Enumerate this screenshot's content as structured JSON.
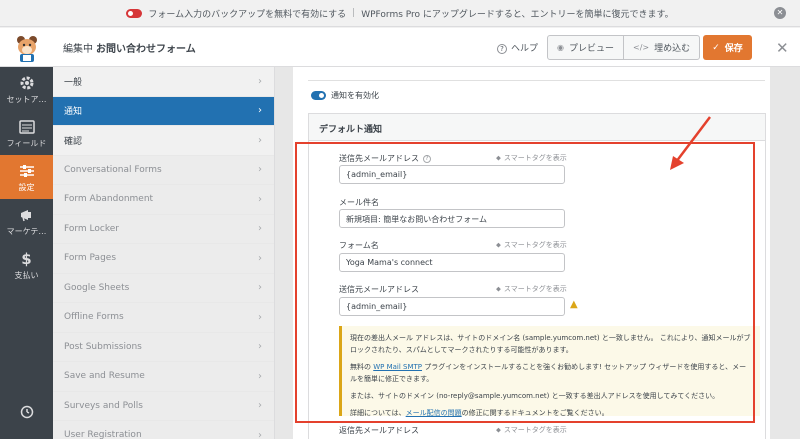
{
  "notice": {
    "toggle_text": "フォーム入力のバックアップを無料で有効にする",
    "separator": "|",
    "upgrade_text": "WPForms Pro にアップグレードすると、エントリーを簡単に復元できます。"
  },
  "header": {
    "editing_prefix": "編集中",
    "form_name": "お問い合わせフォーム",
    "help": "ヘルプ",
    "preview": "プレビュー",
    "embed": "埋め込む",
    "save": "保存"
  },
  "iconbar": {
    "items": [
      {
        "label": "セットア…",
        "icon": "gear-icon"
      },
      {
        "label": "フィールド",
        "icon": "fields-icon"
      },
      {
        "label": "設定",
        "icon": "sliders-icon"
      },
      {
        "label": "マーケテ…",
        "icon": "megaphone-icon"
      },
      {
        "label": "支払い",
        "icon": "dollar-icon"
      }
    ]
  },
  "subnav": {
    "items": [
      {
        "label": "一般"
      },
      {
        "label": "通知"
      },
      {
        "label": "確認"
      },
      {
        "label": "Conversational Forms"
      },
      {
        "label": "Form Abandonment"
      },
      {
        "label": "Form Locker"
      },
      {
        "label": "Form Pages"
      },
      {
        "label": "Google Sheets"
      },
      {
        "label": "Offline Forms"
      },
      {
        "label": "Post Submissions"
      },
      {
        "label": "Save and Resume"
      },
      {
        "label": "Surveys and Polls"
      },
      {
        "label": "User Registration"
      }
    ]
  },
  "main": {
    "enable_label": "通知を有効化",
    "section_title": "デフォルト通知",
    "smart_tag": "スマートタグを表示",
    "fields": [
      {
        "label": "送信先メールアドレス",
        "value": "{admin_email}"
      },
      {
        "label": "メール件名",
        "value": "新規項目: 簡単なお問い合わせフォーム"
      },
      {
        "label": "フォーム名",
        "value": "Yoga Mama's connect"
      },
      {
        "label": "送信元メールアドレス",
        "value": "{admin_email}"
      }
    ],
    "alert": {
      "p1": "現在の差出人メール アドレスは、サイトのドメイン名 (sample.yumcom.net) と一致しません。 これにより、通知メールがブロックされたり、スパムとしてマークされたりする可能性があります。",
      "p2_pre": "無料の",
      "p2_link": "WP Mail SMTP",
      "p2_post": "プラグインをインストールすることを強くお勧めします! セットアップ ウィザードを使用すると、メールを簡単に修正できます。",
      "p3": "または、サイトのドメイン (no-reply@sample.yumcom.net) と一致する差出人アドレスを使用してみてください。",
      "p4_pre": "詳細については、",
      "p4_link": "メール配信の問題",
      "p4_post": "の修正に関するドキュメントをご覧ください。"
    },
    "next_label": "返信先メールアドレス"
  },
  "colors": {
    "accent": "#e27730",
    "primary": "#2271b1",
    "annotation": "#e4412d"
  }
}
